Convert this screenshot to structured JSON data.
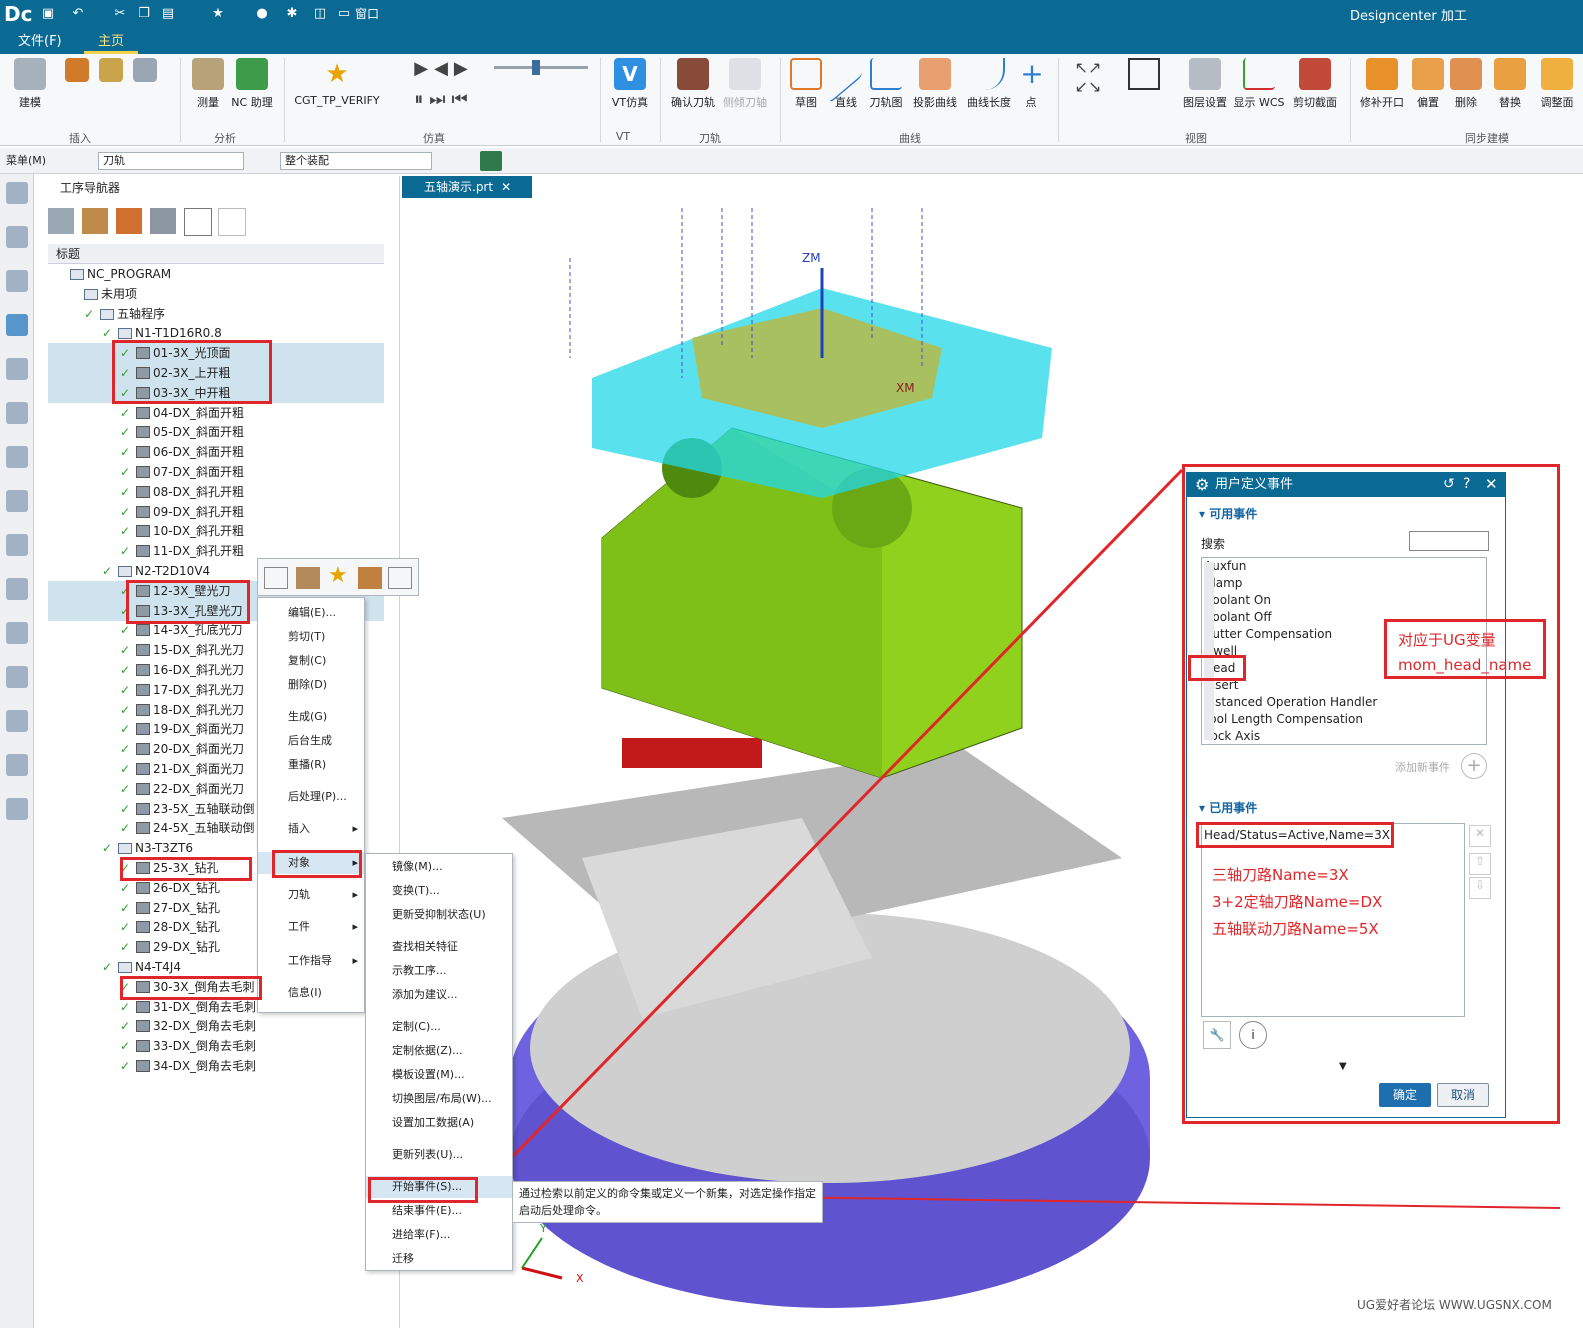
{
  "app": {
    "logo": "Dc",
    "title": "Designcenter 加工",
    "qa_window": "窗口"
  },
  "menu": {
    "file": "文件(F)",
    "home": "主页"
  },
  "ribbon": {
    "buttons": [
      "建模",
      "测量",
      "NC 助理",
      "CGT_TP_VERIFY",
      "VT仿真",
      "确认刀轨",
      "侧倾刀轴",
      "草图",
      "直线",
      "刀轨图",
      "投影曲线",
      "曲线长度",
      "点",
      "图层设置",
      "显示 WCS",
      "剪切截面",
      "修补开口",
      "偏置",
      "删除",
      "替换",
      "调整面"
    ],
    "groups": [
      "插入",
      "分析",
      "仿真",
      "VT",
      "刀轨",
      "曲线",
      "视图",
      "同步建模"
    ]
  },
  "toolbar2": {
    "menu": "菜单(M)",
    "filter1": "刀轨",
    "filter2": "整个装配"
  },
  "navigator": {
    "title": "工序导航器",
    "column": "标题",
    "root": "NC_PROGRAM",
    "unused": "未用项",
    "program": "五轴程序",
    "groups": [
      {
        "name": "N1-T1D16R0.8",
        "ops": [
          "01-3X_光顶面",
          "02-3X_上开粗",
          "03-3X_中开粗",
          "04-DX_斜面开粗",
          "05-DX_斜面开粗",
          "06-DX_斜面开粗",
          "07-DX_斜面开粗",
          "08-DX_斜孔开粗",
          "09-DX_斜孔开粗",
          "10-DX_斜孔开粗",
          "11-DX_斜孔开粗"
        ]
      },
      {
        "name": "N2-T2D10V4",
        "ops": [
          "12-3X_壁光刀",
          "13-3X_孔壁光刀",
          "14-3X_孔底光刀",
          "15-DX_斜孔光刀",
          "16-DX_斜孔光刀",
          "17-DX_斜孔光刀",
          "18-DX_斜孔光刀",
          "19-DX_斜面光刀",
          "20-DX_斜面光刀",
          "21-DX_斜面光刀",
          "22-DX_斜面光刀",
          "23-5X_五轴联动倒",
          "24-5X_五轴联动倒"
        ]
      },
      {
        "name": "N3-T3ZT6",
        "ops": [
          "25-3X_钻孔",
          "26-DX_钻孔",
          "27-DX_钻孔",
          "28-DX_钻孔",
          "29-DX_钻孔"
        ]
      },
      {
        "name": "N4-T4J4",
        "ops": [
          "30-3X_倒角去毛刺",
          "31-DX_倒角去毛刺",
          "32-DX_倒角去毛刺",
          "33-DX_倒角去毛刺",
          "34-DX_倒角去毛刺"
        ]
      }
    ]
  },
  "viewport": {
    "tab": "五轴演示.prt",
    "axis_zm": "ZM",
    "axis_xm": "XM",
    "axis_y": "Y",
    "axis_x": "X"
  },
  "context_menu": [
    "编辑(E)...",
    "剪切(T)",
    "复制(C)",
    "删除(D)",
    "生成(G)",
    "后台生成",
    "重播(R)",
    "后处理(P)...",
    "插入",
    "对象",
    "刀轨",
    "工件",
    "工作指导",
    "信息(I)"
  ],
  "submenu": [
    "镜像(M)...",
    "变换(T)...",
    "更新受抑制状态(U)",
    "查找相关特征",
    "示教工序...",
    "添加为建议...",
    "定制(C)...",
    "定制依据(Z)...",
    "模板设置(M)...",
    "切换图层/布局(W)...",
    "设置加工数据(A)",
    "更新列表(U)...",
    "开始事件(S)...",
    "结束事件(E)...",
    "进给率(F)...",
    "迁移"
  ],
  "tooltip": "通过检索以前定义的命令集或定义一个新集，对选定操作指定启动后处理命令。",
  "dialog": {
    "title": "用户定义事件",
    "available": "可用事件",
    "search": "搜索",
    "events": [
      "Auxfun",
      "Clamp",
      "Coolant On",
      "Coolant Off",
      "Cutter Compensation",
      "Dwell",
      "Head",
      "Insert",
      "Instanced Operation Handler",
      "Tool Length Compensation",
      "Lock Axis"
    ],
    "add_new": "添加新事件",
    "used": "已用事件",
    "used_item": "Head/Status=Active,Name=3X",
    "ok": "确定",
    "cancel": "取消"
  },
  "annotations": {
    "ug_var_line1": "对应于UG变量",
    "ug_var_line2": "mom_head_name",
    "note1": "三轴刀路Name=3X",
    "note2": "3+2定轴刀路Name=DX",
    "note3": "五轴联动刀路Name=5X"
  },
  "watermark": "UG爱好者论坛 WWW.UGSNX.COM",
  "colors": {
    "titlebar": "#0b6a94",
    "accent": "#f3d04a",
    "red": "#e0262a",
    "part": "#8fd11c",
    "table": "#6e62e0",
    "toolpath": "#22d8e8"
  }
}
